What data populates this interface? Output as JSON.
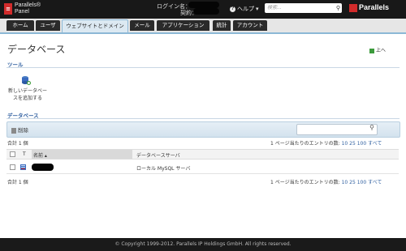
{
  "topbar": {
    "logo_mark": "≡",
    "logo_line1": "Parallels®",
    "logo_line2": "Panel",
    "login_label": "ログイン名：",
    "contract_label": "契約：",
    "help_label": "ヘルプ ▾",
    "search_placeholder": "検索...",
    "search_icon": "search-icon",
    "brand": "Parallels"
  },
  "tabs": [
    {
      "label": "ホーム"
    },
    {
      "label": "ユーザ"
    },
    {
      "label": "ウェブサイトとドメイン"
    },
    {
      "label": "メール"
    },
    {
      "label": "アプリケーション"
    },
    {
      "label": "統計"
    },
    {
      "label": "アカウント"
    }
  ],
  "page": {
    "title": "データベース",
    "up_label": "上へ"
  },
  "tools": {
    "section": "ツール",
    "add_db_line1": "新しいデータベー",
    "add_db_line2": "スを追加する"
  },
  "databases": {
    "section": "データベース",
    "delete_label": "削除",
    "total_top": "合計 1 個",
    "total_bottom": "合計 1 個",
    "per_page_label": "1 ページ当たりのエントリの数:",
    "per_page_options": [
      "10",
      "25",
      "100",
      "すべて"
    ],
    "columns": {
      "type": "T",
      "name": "名前 ▴",
      "server": "データベースサーバ"
    },
    "rows": [
      {
        "server": "ローカル MySQL サーバ"
      }
    ]
  },
  "footer": {
    "copyright": "© Copyright 1999-2012. Parallels IP Holdings GmbH. All rights reserved."
  },
  "colors": {
    "accent": "#2f5fa0",
    "brand_red": "#d22b2b",
    "topbar": "#181818"
  }
}
